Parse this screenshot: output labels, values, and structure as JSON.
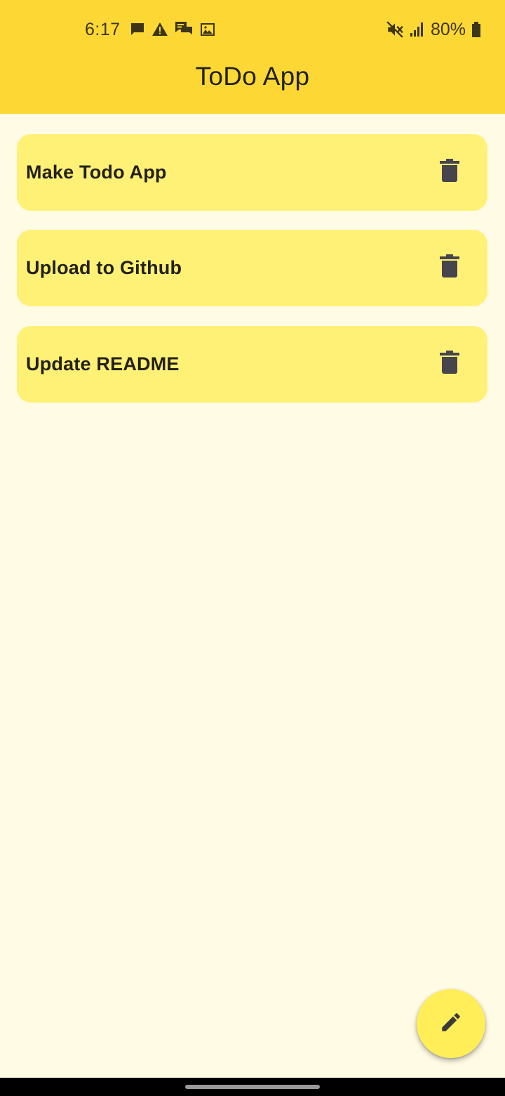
{
  "colors": {
    "app_bar": "#fdd835",
    "background": "#fffbe5",
    "card": "#fff176",
    "icon_dark": "#46454d",
    "status_text": "#3d3513",
    "fab": "#ffee58",
    "nav_bar": "#000000"
  },
  "status_bar": {
    "time": "6:17",
    "left_icons": [
      "chat-bubble-icon",
      "warning-icon",
      "messages-icon",
      "image-icon"
    ],
    "right_icons": [
      "mute-icon",
      "signal-icon",
      "battery-icon"
    ],
    "battery": "80%"
  },
  "app_bar": {
    "title": "ToDo App"
  },
  "todos": [
    {
      "text": "Make Todo App",
      "action_icon": "delete-icon"
    },
    {
      "text": "Upload to Github",
      "action_icon": "delete-icon"
    },
    {
      "text": "Update README",
      "action_icon": "delete-icon"
    }
  ],
  "fab": {
    "icon": "edit-icon"
  }
}
